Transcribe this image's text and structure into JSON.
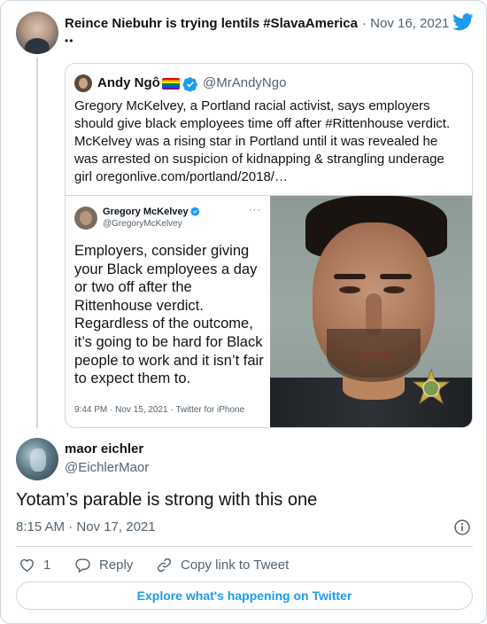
{
  "parent_tweet": {
    "author_name": "Reince Niebuhr is trying lentils #SlavaAmerica",
    "date": "· Nov 16, 2021",
    "emoji": "••"
  },
  "quoted_tweet": {
    "author_name": "Andy Ngô",
    "handle": "@MrAndyNgo",
    "text": "Gregory McKelvey, a Portland racial activist, says employers should give black employees time off after #Rittenhouse verdict. McKelvey was a rising star in Portland until it was revealed he was arrested on suspicion of kidnapping & strangling underage girl oregonlive.com/portland/2018/…",
    "embedded_screenshot": {
      "author_name": "Gregory McKelvey",
      "handle": "@GregoryMcKelvey",
      "more": "···",
      "text": "Employers, consider giving your Black employees a day or two off after the Rittenhouse verdict. Regardless of the outcome, it’s going to be hard for Black people to work and it isn’t fair to expect them to.",
      "footer": "9:44 PM · Nov 15, 2021 · Twitter for iPhone"
    }
  },
  "reply_tweet": {
    "author_name": "maor eichler",
    "handle": "@EichlerMaor",
    "text": "Yotam’s parable is strong with this one",
    "timestamp": "8:15 AM · Nov 17, 2021"
  },
  "actions": {
    "like_count": "1",
    "reply_label": "Reply",
    "copy_link_label": "Copy link to Tweet"
  },
  "explore_button": {
    "label": "Explore what's happening on Twitter"
  },
  "colors": {
    "accent": "#1d9bf0",
    "secondary_text": "#536471",
    "border": "#cfd9de"
  },
  "icons": [
    "twitter-bird-icon",
    "verified-icon",
    "rainbow-flag-icon",
    "sheriff-badge-icon",
    "info-icon",
    "heart-icon",
    "reply-icon",
    "link-icon"
  ]
}
